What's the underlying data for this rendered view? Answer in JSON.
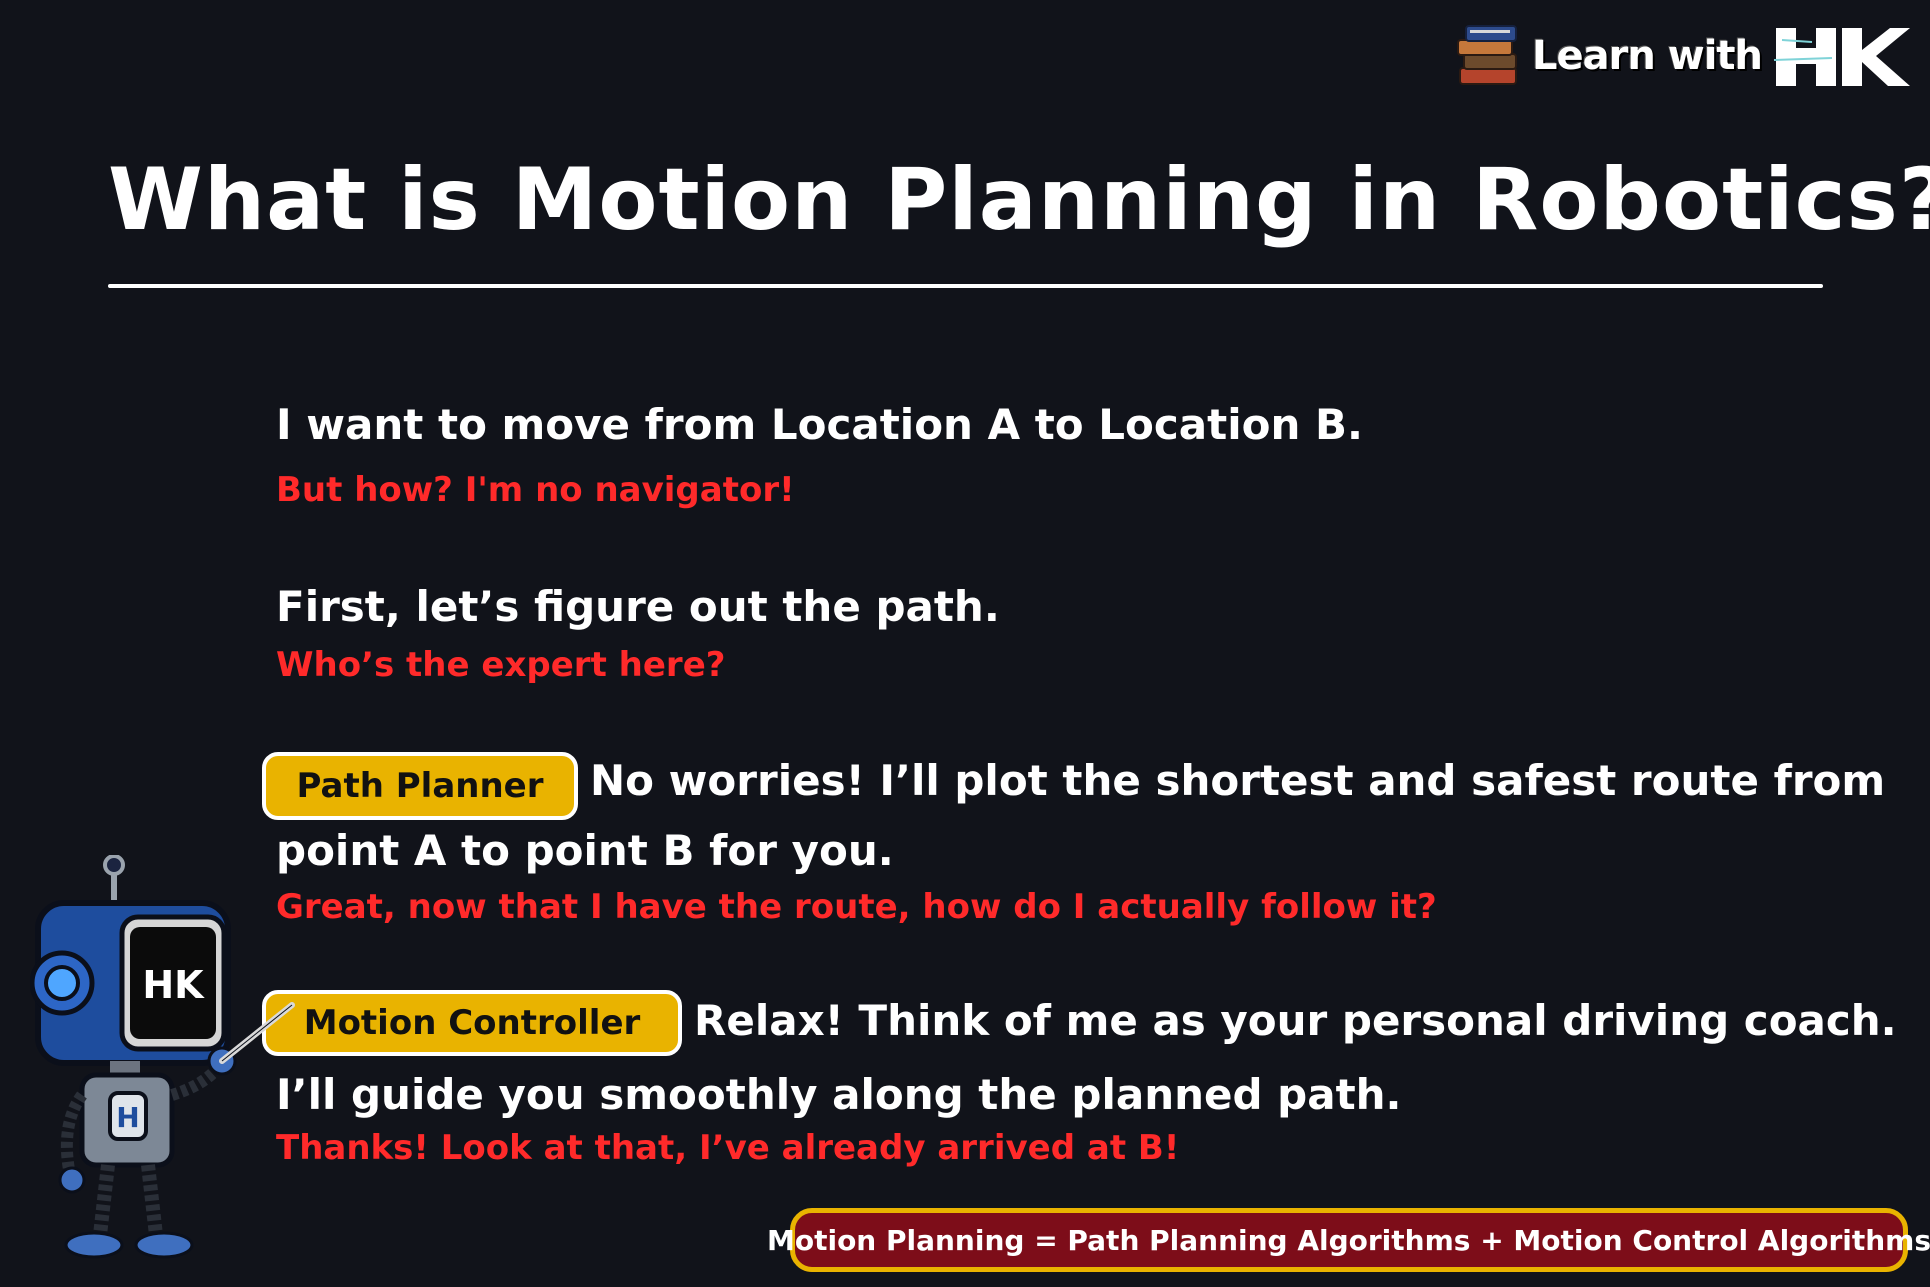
{
  "brand": {
    "text": "Learn with",
    "logo_text": "HK"
  },
  "title": "What is Motion Planning in Robotics?",
  "dialogue": {
    "line1": "I want to move from Location A to Location B.",
    "reply1": "But how? I'm no navigator!",
    "line2": "First, let’s figure out the path.",
    "reply2": "Who’s the expert here?",
    "planner_badge": "Path Planner",
    "planner_line_a": "No worries! I’ll plot the shortest and safest route from",
    "planner_line_b": "point A to point B for you.",
    "reply3": "Great, now that I have the route, how do I actually follow it?",
    "controller_badge": "Motion Controller",
    "controller_line_a": "Relax! Think of me as your personal driving coach.",
    "controller_line_b": "I’ll guide you smoothly along the planned path.",
    "reply4": "Thanks! Look at that, I’ve already arrived at B!"
  },
  "formula": "Motion Planning = Path Planning Algorithms + Motion Control Algorithms",
  "robot": {
    "screen_text": "HK",
    "chest_text": "H"
  },
  "colors": {
    "background": "#11131a",
    "accent_red": "#ff2a2a",
    "badge_yellow": "#e9b300",
    "formula_bg": "#7d0d19"
  }
}
